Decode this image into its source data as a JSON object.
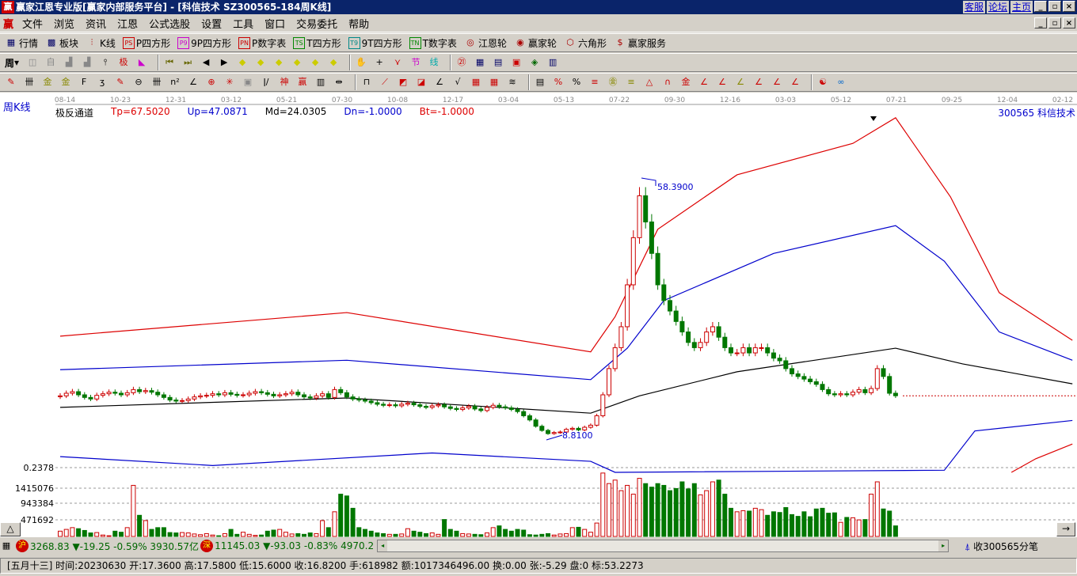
{
  "title": {
    "text": "赢家江恩专业版[赢家内部服务平台] - [科信技术   SZ300565-184周K线]",
    "logo": "赢",
    "links": [
      "客服",
      "论坛",
      "主页"
    ]
  },
  "menu": {
    "logo": "赢",
    "items": [
      "文件",
      "浏览",
      "资讯",
      "江恩",
      "公式选股",
      "设置",
      "工具",
      "窗口",
      "交易委托",
      "帮助"
    ]
  },
  "toolbar1": [
    {
      "icon": "table-icon",
      "glyph": "▦",
      "label": "行情"
    },
    {
      "icon": "grid-icon",
      "glyph": "▩",
      "label": "板块"
    },
    {
      "icon": "candle-icon",
      "glyph": "⫶",
      "label": "K线"
    },
    {
      "icon": "ps-icon",
      "glyph": "PS",
      "label": "P四方形"
    },
    {
      "icon": "p9-icon",
      "glyph": "P9",
      "label": "9P四方形"
    },
    {
      "icon": "pn-icon",
      "glyph": "PN",
      "label": "P数字表"
    },
    {
      "icon": "ts-icon",
      "glyph": "TS",
      "label": "T四方形"
    },
    {
      "icon": "t9-icon",
      "glyph": "T9",
      "label": "9T四方形"
    },
    {
      "icon": "tn-icon",
      "glyph": "TN",
      "label": "T数字表"
    },
    {
      "icon": "gann-wheel-icon",
      "glyph": "◎",
      "label": "江恩轮"
    },
    {
      "icon": "winner-wheel-icon",
      "glyph": "◉",
      "label": "赢家轮"
    },
    {
      "icon": "hexagon-icon",
      "glyph": "⬡",
      "label": "六角形"
    },
    {
      "icon": "dollar-icon",
      "glyph": "$",
      "label": "赢家服务"
    }
  ],
  "period_selector": "周",
  "chart_header": {
    "period_label": "周K线",
    "indicator": "极反通道",
    "tp": "Tp=67.5020",
    "up": "Up=47.0871",
    "md": "Md=24.0305",
    "dn": "Dn=-1.0000",
    "bt": "Bt=-1.0000",
    "stock": "300565  科信技术"
  },
  "colors": {
    "up": "#cc0000",
    "down": "#007700",
    "tp": "#dd0000",
    "band": "#0000cc",
    "md": "#000000"
  },
  "chart_data": {
    "type": "candlestick",
    "x_ticks": [
      "08-14",
      "10-23",
      "12-31",
      "03-12",
      "05-21",
      "07-30",
      "10-08",
      "12-17",
      "03-04",
      "05-13",
      "07-22",
      "09-30",
      "12-16",
      "03-03",
      "05-12",
      "07-21",
      "09-25",
      "12-04",
      "02-12"
    ],
    "closes": [
      16.8,
      17.3,
      17.6,
      17.0,
      16.5,
      16.2,
      16.9,
      17.2,
      17.5,
      17.3,
      17.0,
      17.4,
      18.0,
      17.6,
      17.8,
      17.5,
      17.0,
      16.5,
      16.0,
      15.8,
      15.9,
      16.2,
      16.6,
      16.8,
      16.9,
      17.2,
      17.0,
      17.4,
      17.1,
      16.9,
      17.0,
      17.3,
      17.6,
      17.4,
      17.1,
      16.8,
      17.0,
      17.2,
      17.5,
      17.0,
      16.6,
      16.4,
      16.8,
      17.2,
      16.5,
      18.0,
      17.4,
      16.6,
      16.2,
      16.0,
      15.8,
      15.5,
      15.2,
      15.0,
      15.1,
      14.9,
      15.2,
      15.4,
      15.1,
      14.8,
      14.6,
      14.9,
      15.1,
      14.7,
      14.4,
      14.2,
      14.5,
      14.8,
      14.3,
      14.0,
      14.6,
      15.0,
      14.7,
      14.5,
      14.2,
      13.8,
      13.0,
      12.2,
      11.0,
      10.2,
      9.6,
      9.8,
      9.9,
      10.4,
      10.6,
      10.3,
      10.8,
      11.2,
      13.0,
      17,
      22,
      26,
      30,
      38,
      47,
      55,
      50,
      44,
      38,
      35,
      33,
      31,
      29,
      27,
      26,
      27,
      29,
      30,
      28,
      26,
      25,
      25,
      26,
      25,
      26,
      26,
      25,
      24,
      23.5,
      22,
      21,
      20.5,
      20,
      19.5,
      19,
      18,
      17.2,
      17,
      17.2,
      17,
      17.5,
      18,
      17.4,
      18.2,
      22,
      20.5,
      17.3,
      16.82
    ],
    "volumes": [
      150,
      200,
      250,
      220,
      170,
      100,
      110,
      40,
      20,
      150,
      120,
      250,
      1450,
      600,
      450,
      200,
      250,
      250,
      110,
      100,
      110,
      100,
      70,
      50,
      80,
      40,
      20,
      80,
      200,
      60,
      120,
      60,
      30,
      40,
      150,
      180,
      200,
      120,
      70,
      80,
      60,
      100,
      80,
      450,
      250,
      700,
      1200,
      1150,
      800,
      250,
      200,
      150,
      100,
      80,
      60,
      60,
      70,
      220,
      150,
      120,
      80,
      100,
      60,
      480,
      200,
      150,
      80,
      70,
      60,
      50,
      100,
      250,
      300,
      200,
      150,
      200,
      180,
      50,
      40,
      60,
      80,
      40,
      70,
      80,
      250,
      260,
      200,
      120,
      380,
      1800,
      1500,
      1600,
      1300,
      1450,
      1200,
      1650,
      1500,
      1400,
      1500,
      1450,
      1300,
      1360,
      1550,
      1350,
      1500,
      1180,
      1300,
      1550,
      1600,
      1200,
      800,
      700,
      730,
      720,
      800,
      760,
      600,
      700,
      680,
      820,
      620,
      570,
      700,
      560,
      780,
      800,
      660,
      670,
      400,
      540,
      530,
      470,
      480,
      1200,
      1550,
      780,
      720,
      300
    ],
    "volume_unit": "thousand shares",
    "bands": {
      "tp": [
        [
          0,
          28.2
        ],
        [
          47,
          32.7
        ],
        [
          87,
          25.2
        ],
        [
          91,
          31.9
        ],
        [
          98,
          48.6
        ],
        [
          111,
          59
        ],
        [
          130,
          65
        ],
        [
          137,
          69.9
        ],
        [
          146,
          54.8
        ],
        [
          154,
          36.5
        ],
        [
          166,
          27.4
        ]
      ],
      "up": [
        [
          0,
          21.8
        ],
        [
          47,
          23.6
        ],
        [
          87,
          19.9
        ],
        [
          93,
          25.9
        ],
        [
          99,
          35
        ],
        [
          117,
          44
        ],
        [
          137,
          49.3
        ],
        [
          145,
          42.5
        ],
        [
          154,
          29
        ],
        [
          166,
          23.6
        ]
      ],
      "md": [
        [
          0,
          14.6
        ],
        [
          47,
          16.4
        ],
        [
          87,
          13.5
        ],
        [
          95,
          16.8
        ],
        [
          111,
          21.4
        ],
        [
          137,
          25.9
        ],
        [
          148,
          22.9
        ],
        [
          166,
          19.1
        ]
      ],
      "dn": [
        [
          0,
          5.2
        ],
        [
          25,
          3.5
        ],
        [
          61,
          5.9
        ],
        [
          87,
          4.3
        ],
        [
          91,
          2.2
        ],
        [
          145,
          2.6
        ],
        [
          150,
          10.1
        ],
        [
          166,
          12.1
        ]
      ],
      "bt": [
        [
          156,
          2.0
        ],
        [
          160,
          4.8
        ],
        [
          166,
          7.6
        ]
      ]
    },
    "annotations": {
      "high": "58.3900",
      "low": "8.8100",
      "axis_low": "0.2378"
    },
    "volume_ticks": [
      "1415076",
      "943384",
      "471692"
    ]
  },
  "status": {
    "sh_label": "沪",
    "sh": "3268.83 ▼-19.25 -0.59% 3930.57亿",
    "sz_label": "深",
    "sz": "11145.03 ▼-93.03 -0.83% 4970.2",
    "tick_label": "收300565分笔"
  },
  "bottom": {
    "text": "[五月十三] 时间:20230630 开:17.3600 高:17.5800 低:15.6000 收:16.8200 手:618982 额:1017346496.00 换:0.00 张:-5.29 盘:0 标:53.2273"
  }
}
